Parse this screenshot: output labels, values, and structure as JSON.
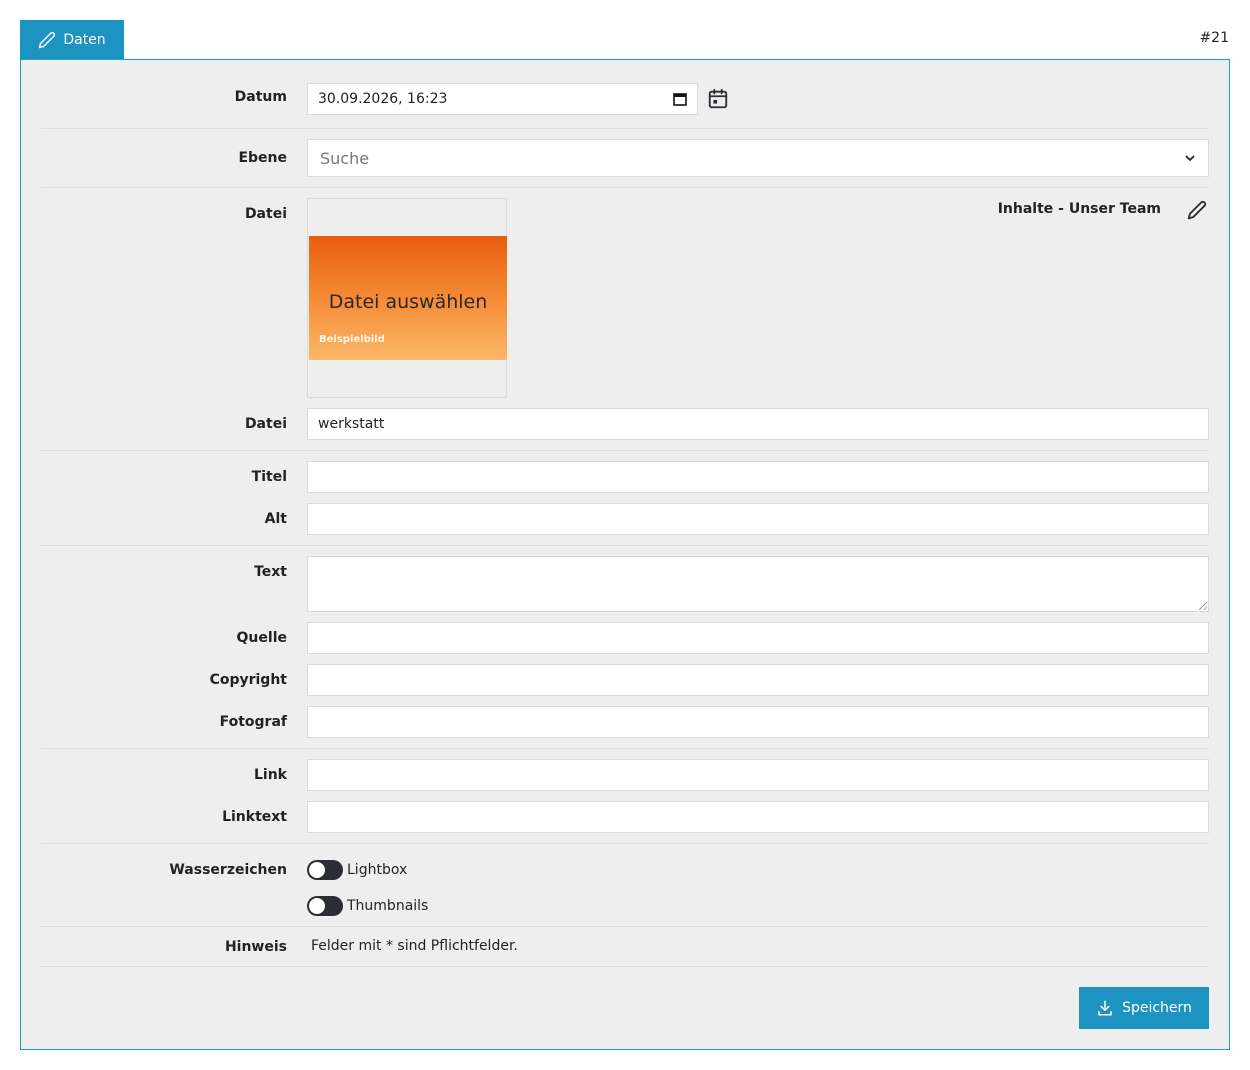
{
  "tabs": [
    {
      "label": "Daten",
      "icon": "pencil-icon"
    }
  ],
  "record_id": "#21",
  "colors": {
    "accent": "#1d93c1",
    "panel_border": "#1aa6a6",
    "panel_bg": "#eeeeee",
    "toggle_off": "#2a2d33"
  },
  "form": {
    "datum": {
      "label": "Datum",
      "value": "30.09.2026, 16:23"
    },
    "ebene": {
      "label": "Ebene",
      "placeholder": "Suche"
    },
    "datei_picker": {
      "label": "Datei",
      "button_text": "Datei auswählen",
      "image_caption": "Beispielbild",
      "context_title": "Inhalte - Unser Team"
    },
    "datei_name": {
      "label": "Datei",
      "value": "werkstatt"
    },
    "titel": {
      "label": "Titel",
      "value": ""
    },
    "alt": {
      "label": "Alt",
      "value": ""
    },
    "text": {
      "label": "Text",
      "value": ""
    },
    "quelle": {
      "label": "Quelle",
      "value": ""
    },
    "copyright": {
      "label": "Copyright",
      "value": ""
    },
    "fotograf": {
      "label": "Fotograf",
      "value": ""
    },
    "link": {
      "label": "Link",
      "value": ""
    },
    "linktext": {
      "label": "Linktext",
      "value": ""
    },
    "wasserzeichen": {
      "label": "Wasserzeichen",
      "toggles": [
        {
          "label": "Lightbox",
          "on": false
        },
        {
          "label": "Thumbnails",
          "on": false
        }
      ]
    },
    "hinweis": {
      "label": "Hinweis",
      "text": "Felder mit * sind Pflichtfelder."
    }
  },
  "actions": {
    "save_label": "Speichern"
  }
}
